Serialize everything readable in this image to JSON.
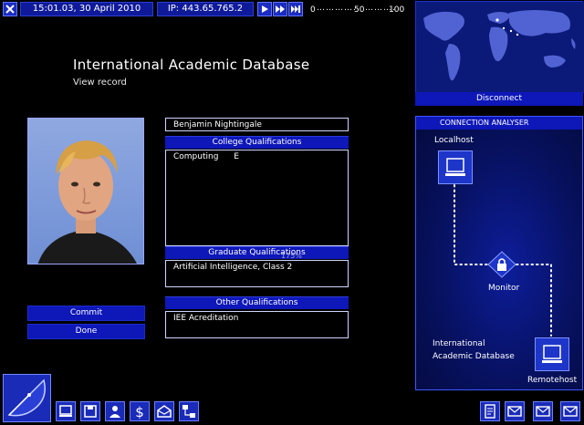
{
  "topbar": {
    "datetime": "15:01.03, 30 April 2010",
    "ip": "IP: 443.65.765.2",
    "scale_start": "0",
    "scale_mid": "50",
    "scale_end": "100"
  },
  "record": {
    "title": "International Academic Database",
    "subtitle": "View record",
    "name": "Benjamin Nightingale",
    "college_header": "College Qualifications",
    "college_subject": "Computing",
    "college_grade": "E",
    "graduate_header": "Graduate Qualifications",
    "graduate_value": "Artificial Intelligence, Class 2",
    "other_header": "Other Qualifications",
    "other_value": "IEE Acreditation",
    "overlay_text": "175%"
  },
  "actions": {
    "commit": "Commit",
    "done": "Done"
  },
  "right_panel": {
    "disconnect": "Disconnect",
    "analyser_title": "CONNECTION ANALYSER",
    "localhost": "Localhost",
    "monitor": "Monitor",
    "remote_line1": "International",
    "remote_line2": "Academic Database",
    "remotehost": "Remotehost"
  },
  "colors": {
    "accent_blue": "#0e17b8",
    "panel_dark": "#07115f",
    "link_dots": "#ffffff"
  },
  "icons": {
    "toolbar": [
      "close-icon",
      "play-icon",
      "fast-forward-icon",
      "skip-forward-icon"
    ],
    "bottom_left": [
      "satellite-dish-icon",
      "computer-icon",
      "save-disk-icon",
      "user-people-icon",
      "dollar-icon",
      "mail-open-icon",
      "network-icon"
    ],
    "bottom_right": [
      "notepad-icon",
      "mail-icon",
      "mail-icon",
      "mail-icon"
    ]
  }
}
